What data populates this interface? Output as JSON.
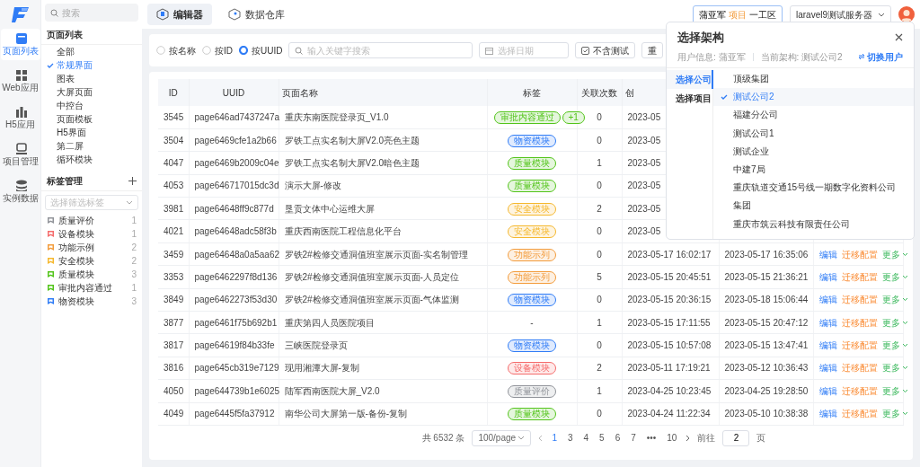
{
  "rail": [
    {
      "label": "页面列表",
      "kind": "pages",
      "selected": true
    },
    {
      "label": "Web应用",
      "kind": "web",
      "selected": false
    },
    {
      "label": "H5应用",
      "kind": "h5",
      "selected": false
    },
    {
      "label": "项目管理",
      "kind": "project",
      "selected": false
    },
    {
      "label": "实例数据",
      "kind": "data",
      "selected": false
    }
  ],
  "sidebar": {
    "search_placeholder": "搜索",
    "pages_title": "页面列表",
    "pages": [
      {
        "label": "全部",
        "selected": false
      },
      {
        "label": "常规界面",
        "selected": true
      },
      {
        "label": "图表",
        "selected": false
      },
      {
        "label": "大屏页面",
        "selected": false
      },
      {
        "label": "中控台",
        "selected": false
      },
      {
        "label": "页面模板",
        "selected": false
      },
      {
        "label": "H5界面",
        "selected": false
      },
      {
        "label": "第二屏",
        "selected": false
      },
      {
        "label": "循环模块",
        "selected": false
      }
    ],
    "tags_title": "标签管理",
    "tag_filter_placeholder": "选择筛选标签",
    "tags": [
      {
        "label": "质量评价",
        "color": "#909399",
        "count": "1"
      },
      {
        "label": "设备模块",
        "color": "#f56c6c",
        "count": "1"
      },
      {
        "label": "功能示例",
        "color": "#f39c3c",
        "count": "2"
      },
      {
        "label": "安全模块",
        "color": "#f5b82e",
        "count": "2"
      },
      {
        "label": "质量模块",
        "color": "#52c41a",
        "count": "3"
      },
      {
        "label": "审批内容通过",
        "color": "#52c41a",
        "count": "1"
      },
      {
        "label": "物资模块",
        "color": "#2f7cf6",
        "count": "3"
      }
    ]
  },
  "top_tabs": [
    {
      "label": "编辑器",
      "selected": true
    },
    {
      "label": "数据仓库",
      "selected": false
    }
  ],
  "project_chip": {
    "user": "蒲亚军",
    "kind_label": "项目",
    "project": "一工区"
  },
  "server_select": {
    "value": "laravel9测试服务器"
  },
  "filters": {
    "modes": [
      {
        "label": "按名称",
        "selected": false
      },
      {
        "label": "按ID",
        "selected": false
      },
      {
        "label": "按UUID",
        "selected": true
      }
    ],
    "search_placeholder": "输入关键字搜索",
    "date_placeholder": "选择日期",
    "buttons": [
      "不含测试",
      "重"
    ]
  },
  "table": {
    "columns": [
      "ID",
      "UUID",
      "页面名称",
      "标签",
      "关联次数",
      "创"
    ],
    "rows": [
      {
        "id": "3545",
        "uuid": "page646ad7437247a",
        "name": "重庆东南医院登录页_V1.0",
        "tags": [
          {
            "label": "审批内容通过",
            "color": "#52c41a"
          },
          {
            "label": "+1",
            "color": "#52c41a"
          }
        ],
        "count": "0",
        "created": "2023-05"
      },
      {
        "id": "3504",
        "uuid": "page6469cfe1a2b66",
        "name": "罗铁工点实名制大屏V2.0亮色主题",
        "tags": [
          {
            "label": "物资模块",
            "color": "#2f7cf6"
          }
        ],
        "count": "0",
        "created": "2023-05"
      },
      {
        "id": "4047",
        "uuid": "page6469b2009c04e",
        "name": "罗铁工点实名制大屏V2.0暗色主题",
        "tags": [
          {
            "label": "质量模块",
            "color": "#52c41a"
          }
        ],
        "count": "1",
        "created": "2023-05"
      },
      {
        "id": "4053",
        "uuid": "page646717015dc3d",
        "name": "演示大屏-修改",
        "tags": [
          {
            "label": "质量模块",
            "color": "#52c41a"
          }
        ],
        "count": "0",
        "created": "2023-05"
      },
      {
        "id": "3981",
        "uuid": "page64648ff9c877d",
        "name": "垦贡文体中心运维大屏",
        "tags": [
          {
            "label": "安全模块",
            "color": "#f5b82e"
          }
        ],
        "count": "2",
        "created": "2023-05"
      },
      {
        "id": "4021",
        "uuid": "page64648adc58f3b",
        "name": "重庆西南医院工程信息化平台",
        "tags": [
          {
            "label": "安全模块",
            "color": "#f5b82e"
          }
        ],
        "count": "0",
        "created": "2023-05"
      },
      {
        "id": "3459",
        "uuid": "page64648a0a5aa62",
        "name": "罗铁2#检修交通洞值班室展示页面-实名制管理",
        "tags": [
          {
            "label": "功能示列",
            "color": "#f39c3c"
          }
        ],
        "count": "0",
        "created": "2023-05-17 16:02:17",
        "updated": "2023-05-17 16:35:06",
        "actions": [
          {
            "label": "编辑",
            "kind": "edit"
          },
          {
            "label": "迁移配置",
            "kind": "migrate"
          },
          {
            "label": "更多",
            "kind": "more"
          }
        ]
      },
      {
        "id": "3353",
        "uuid": "page6462297f8d136",
        "name": "罗铁2#检修交通洞值班室展示页面-人员定位",
        "tags": [
          {
            "label": "功能示列",
            "color": "#f39c3c"
          }
        ],
        "count": "5",
        "created": "2023-05-15 20:45:51",
        "updated": "2023-05-15 21:36:21",
        "actions": [
          {
            "label": "编辑",
            "kind": "edit"
          },
          {
            "label": "迁移配置",
            "kind": "migrate"
          },
          {
            "label": "更多",
            "kind": "more"
          }
        ]
      },
      {
        "id": "3849",
        "uuid": "page6462273f53d30",
        "name": "罗铁2#检修交通洞值班室展示页面-气体监测",
        "tags": [
          {
            "label": "物资模块",
            "color": "#2f7cf6"
          }
        ],
        "count": "0",
        "created": "2023-05-15 20:36:15",
        "updated": "2023-05-18 15:06:44",
        "actions": [
          {
            "label": "编辑",
            "kind": "edit"
          },
          {
            "label": "迁移配置",
            "kind": "migrate"
          },
          {
            "label": "更多",
            "kind": "more"
          }
        ]
      },
      {
        "id": "3877",
        "uuid": "page6461f75b692b1",
        "name": "重庆第四人员医院项目",
        "tag_text": "-",
        "count": "1",
        "created": "2023-05-15 17:11:55",
        "updated": "2023-05-15 20:47:12",
        "actions": [
          {
            "label": "编辑",
            "kind": "edit"
          },
          {
            "label": "迁移配置",
            "kind": "migrate"
          },
          {
            "label": "更多",
            "kind": "more"
          }
        ]
      },
      {
        "id": "3817",
        "uuid": "page64619f84b33fe",
        "name": "三峡医院登录页",
        "tags": [
          {
            "label": "物资模块",
            "color": "#2f7cf6"
          }
        ],
        "count": "0",
        "created": "2023-05-15 10:57:08",
        "updated": "2023-05-15 13:47:41",
        "actions": [
          {
            "label": "编辑",
            "kind": "edit"
          },
          {
            "label": "迁移配置",
            "kind": "migrate"
          },
          {
            "label": "更多",
            "kind": "more"
          }
        ]
      },
      {
        "id": "3816",
        "uuid": "page645cb319e7129",
        "name": "现用湘潭大屏-复制",
        "tags": [
          {
            "label": "设备模块",
            "color": "#f56c6c"
          }
        ],
        "count": "2",
        "created": "2023-05-11 17:19:21",
        "updated": "2023-05-12 10:36:43",
        "actions": [
          {
            "label": "编辑",
            "kind": "edit"
          },
          {
            "label": "迁移配置",
            "kind": "migrate"
          },
          {
            "label": "更多",
            "kind": "more"
          }
        ]
      },
      {
        "id": "4050",
        "uuid": "page644739b1e6025",
        "name": "陆军西南医院大屏_V2.0",
        "tags": [
          {
            "label": "质量评价",
            "color": "#909399"
          }
        ],
        "count": "1",
        "created": "2023-04-25 10:23:45",
        "updated": "2023-04-25 19:28:50",
        "actions": [
          {
            "label": "编辑",
            "kind": "edit"
          },
          {
            "label": "迁移配置",
            "kind": "migrate"
          },
          {
            "label": "更多",
            "kind": "more"
          }
        ]
      },
      {
        "id": "4049",
        "uuid": "page6445f5fa37912",
        "name": "南华公司大屏第一版-备份-复制",
        "tags": [
          {
            "label": "质量模块",
            "color": "#52c41a"
          }
        ],
        "count": "0",
        "created": "2023-04-24 11:22:34",
        "updated": "2023-05-10 10:38:38",
        "actions": [
          {
            "label": "编辑",
            "kind": "edit"
          },
          {
            "label": "迁移配置",
            "kind": "migrate"
          },
          {
            "label": "更多",
            "kind": "more"
          }
        ]
      }
    ]
  },
  "pagination": {
    "total": "共 6532 条",
    "page_size": "100/page",
    "pages": [
      {
        "label": "1",
        "selected": true
      },
      {
        "label": "3",
        "selected": false
      },
      {
        "label": "4",
        "selected": false
      },
      {
        "label": "5",
        "selected": false
      },
      {
        "label": "6",
        "selected": false
      },
      {
        "label": "7",
        "selected": false
      },
      {
        "label": "•••",
        "selected": false
      },
      {
        "label": "10",
        "selected": false
      }
    ],
    "jump_label": "前往",
    "jump_value": "2",
    "jump_suffix": "页"
  },
  "popover": {
    "title": "选择架构",
    "user_info": "用户信息: 蒲亚军",
    "current": "当前架构: 测试公司2",
    "switch_label": "切换用户",
    "tabs": [
      {
        "label": "选择公司",
        "selected": true
      },
      {
        "label": "选择项目",
        "selected": false
      }
    ],
    "items": [
      {
        "label": "顶级集团",
        "selected": false
      },
      {
        "label": "测试公司2",
        "selected": true
      },
      {
        "label": "福建分公司",
        "selected": false
      },
      {
        "label": "测试公司1",
        "selected": false
      },
      {
        "label": "测试企业",
        "selected": false
      },
      {
        "label": "中建7局",
        "selected": false
      },
      {
        "label": "重庆轨道交通15号线一期数字化资料公司",
        "selected": false
      },
      {
        "label": "集团",
        "selected": false
      },
      {
        "label": "重庆市筑云科技有限责任公司",
        "selected": false
      }
    ]
  }
}
